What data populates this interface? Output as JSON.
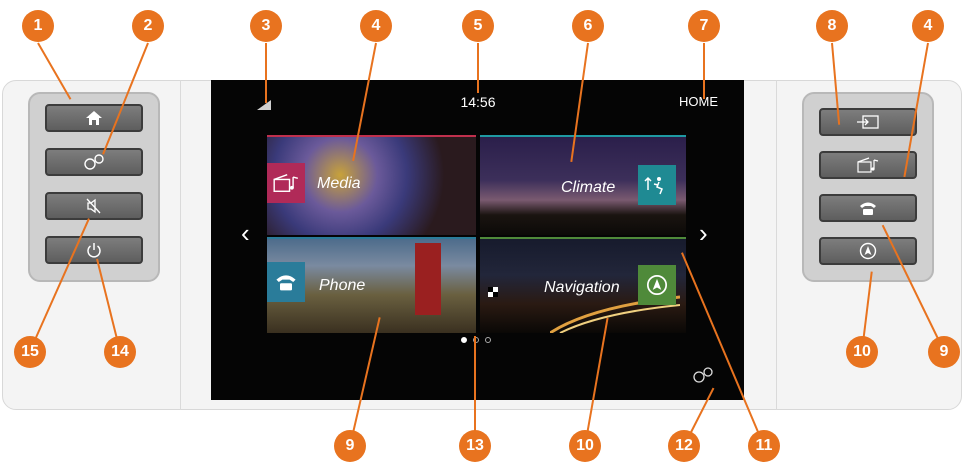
{
  "status_bar": {
    "time": "14:56",
    "mode": "HOME"
  },
  "tiles": [
    {
      "label": "Media",
      "icon": "media-clapper-note-icon"
    },
    {
      "label": "Climate",
      "icon": "climate-airflow-icon"
    },
    {
      "label": "Phone",
      "icon": "phone-icon"
    },
    {
      "label": "Navigation",
      "icon": "navigation-compass-icon"
    }
  ],
  "page_indicator": {
    "count": 3,
    "active": 1
  },
  "left_buttons": [
    "home-icon",
    "settings-gears-icon",
    "mute-icon",
    "power-icon"
  ],
  "right_buttons": [
    "source-input-icon",
    "media-clapper-note-icon",
    "phone-icon",
    "navigation-compass-icon"
  ],
  "callouts": [
    "1",
    "2",
    "3",
    "4",
    "5",
    "6",
    "7",
    "8",
    "4",
    "15",
    "14",
    "10",
    "9",
    "9",
    "13",
    "10",
    "12",
    "11"
  ],
  "colors": {
    "callout": "#e8731f",
    "screen": "#050505",
    "media_accent": "#b02a58",
    "climate_accent": "#1f8a93",
    "phone_accent": "#2a7c9a",
    "nav_accent": "#4f8a3a"
  }
}
